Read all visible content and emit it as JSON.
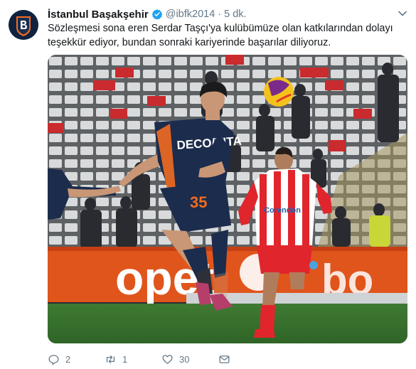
{
  "tweet": {
    "author_name": "İstanbul Başakşehir",
    "handle": "@ibfk2014",
    "separator": "·",
    "time": "5 dk.",
    "text_line1": "Sözleşmesi sona eren Serdar Taşçı'ya kulübümüze olan katkılarından dolayı",
    "text_line2": "teşekkür ediyor, bundan sonraki kariyerinde başarılar diliyoruz."
  },
  "media": {
    "jersey_sponsor": "DECO/VITA",
    "jersey_number": "35",
    "opponent_sponsor": "Corendon",
    "board_text": "opet"
  },
  "actions": {
    "reply_count": "2",
    "retweet_count": "1",
    "like_count": "30"
  },
  "colors": {
    "text": "#14171a",
    "muted": "#657786",
    "verified_blue": "#1da1f2",
    "team_navy": "#1c2c4c",
    "team_orange": "#f26b21",
    "opponent_red": "#e1252c"
  }
}
